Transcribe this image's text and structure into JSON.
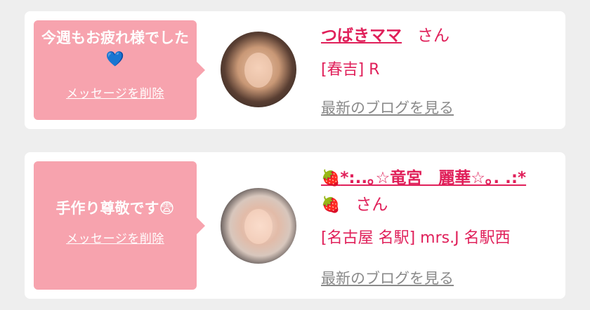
{
  "messages": [
    {
      "text": "今週もお疲れ様でした💙",
      "delete_label": "メッセージを削除",
      "sender_name": "つばきママ",
      "honorific": "さん",
      "shop": "[春吉] R",
      "blog_link": "最新のブログを見る"
    },
    {
      "text": "手作り尊敬です😨",
      "delete_label": "メッセージを削除",
      "sender_name": "*:..｡☆竜宮　麗華☆｡. .:*",
      "berry": "🍓",
      "honorific": "さん",
      "shop": "[名古屋 名駅] mrs.J 名駅西",
      "blog_link": "最新のブログを見る"
    }
  ],
  "colors": {
    "bubble": "#f7a3ae",
    "accent": "#e0205a",
    "link_gray": "#8a8a8a",
    "background": "#eeeeee"
  }
}
